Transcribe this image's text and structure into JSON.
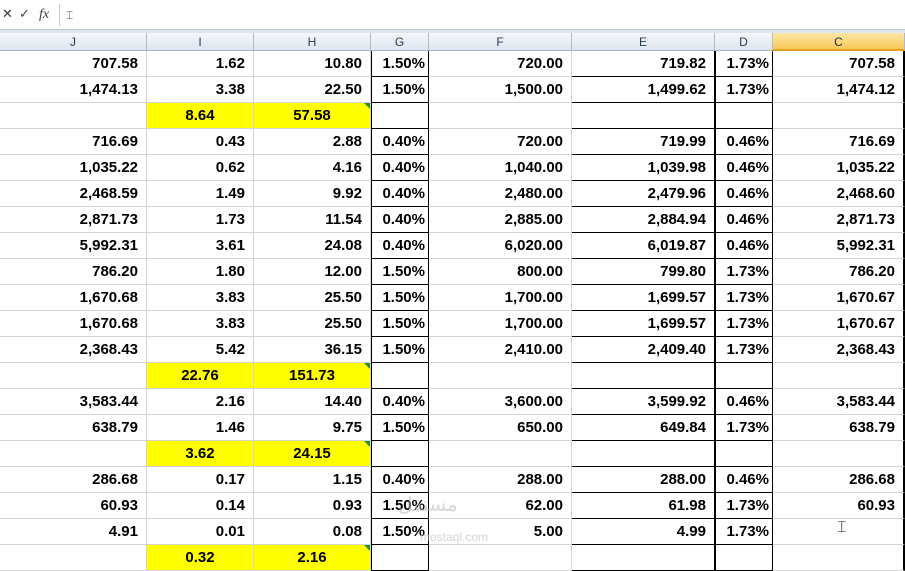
{
  "formula_bar": {
    "cancel_icon": "✕",
    "enter_icon": "✓",
    "fx_label": "fx",
    "value": ""
  },
  "columns": [
    "J",
    "I",
    "H",
    "G",
    "F",
    "E",
    "D",
    "C"
  ],
  "selected_column": "C",
  "rows": [
    {
      "J": "707.58",
      "I": "1.62",
      "H": "10.80",
      "G": "1.50%",
      "F": "720.00",
      "E": "719.82",
      "D": "1.73%",
      "C": "707.58"
    },
    {
      "J": "1,474.13",
      "I": "3.38",
      "H": "22.50",
      "G": "1.50%",
      "F": "1,500.00",
      "E": "1,499.62",
      "D": "1.73%",
      "C": "1,474.12"
    },
    {
      "J": "",
      "I": "8.64",
      "H": "57.58",
      "G": "",
      "F": "",
      "E": "",
      "D": "",
      "C": "",
      "yellow": true
    },
    {
      "J": "716.69",
      "I": "0.43",
      "H": "2.88",
      "G": "0.40%",
      "F": "720.00",
      "E": "719.99",
      "D": "0.46%",
      "C": "716.69"
    },
    {
      "J": "1,035.22",
      "I": "0.62",
      "H": "4.16",
      "G": "0.40%",
      "F": "1,040.00",
      "E": "1,039.98",
      "D": "0.46%",
      "C": "1,035.22"
    },
    {
      "J": "2,468.59",
      "I": "1.49",
      "H": "9.92",
      "G": "0.40%",
      "F": "2,480.00",
      "E": "2,479.96",
      "D": "0.46%",
      "C": "2,468.60"
    },
    {
      "J": "2,871.73",
      "I": "1.73",
      "H": "11.54",
      "G": "0.40%",
      "F": "2,885.00",
      "E": "2,884.94",
      "D": "0.46%",
      "C": "2,871.73"
    },
    {
      "J": "5,992.31",
      "I": "3.61",
      "H": "24.08",
      "G": "0.40%",
      "F": "6,020.00",
      "E": "6,019.87",
      "D": "0.46%",
      "C": "5,992.31"
    },
    {
      "J": "786.20",
      "I": "1.80",
      "H": "12.00",
      "G": "1.50%",
      "F": "800.00",
      "E": "799.80",
      "D": "1.73%",
      "C": "786.20"
    },
    {
      "J": "1,670.68",
      "I": "3.83",
      "H": "25.50",
      "G": "1.50%",
      "F": "1,700.00",
      "E": "1,699.57",
      "D": "1.73%",
      "C": "1,670.67"
    },
    {
      "J": "1,670.68",
      "I": "3.83",
      "H": "25.50",
      "G": "1.50%",
      "F": "1,700.00",
      "E": "1,699.57",
      "D": "1.73%",
      "C": "1,670.67"
    },
    {
      "J": "2,368.43",
      "I": "5.42",
      "H": "36.15",
      "G": "1.50%",
      "F": "2,410.00",
      "E": "2,409.40",
      "D": "1.73%",
      "C": "2,368.43"
    },
    {
      "J": "",
      "I": "22.76",
      "H": "151.73",
      "G": "",
      "F": "",
      "E": "",
      "D": "",
      "C": "",
      "yellow": true
    },
    {
      "J": "3,583.44",
      "I": "2.16",
      "H": "14.40",
      "G": "0.40%",
      "F": "3,600.00",
      "E": "3,599.92",
      "D": "0.46%",
      "C": "3,583.44"
    },
    {
      "J": "638.79",
      "I": "1.46",
      "H": "9.75",
      "G": "1.50%",
      "F": "650.00",
      "E": "649.84",
      "D": "1.73%",
      "C": "638.79"
    },
    {
      "J": "",
      "I": "3.62",
      "H": "24.15",
      "G": "",
      "F": "",
      "E": "",
      "D": "",
      "C": "",
      "yellow": true
    },
    {
      "J": "286.68",
      "I": "0.17",
      "H": "1.15",
      "G": "0.40%",
      "F": "288.00",
      "E": "288.00",
      "D": "0.46%",
      "C": "286.68"
    },
    {
      "J": "60.93",
      "I": "0.14",
      "H": "0.93",
      "G": "1.50%",
      "F": "62.00",
      "E": "61.98",
      "D": "1.73%",
      "C": "60.93"
    },
    {
      "J": "4.91",
      "I": "0.01",
      "H": "0.08",
      "G": "1.50%",
      "F": "5.00",
      "E": "4.99",
      "D": "1.73%",
      "C": ""
    },
    {
      "J": "",
      "I": "0.32",
      "H": "2.16",
      "G": "",
      "F": "",
      "E": "",
      "D": "",
      "C": "",
      "yellow": true
    }
  ],
  "watermark": "مستقل",
  "watermark_url": "mostaql.com",
  "colors": {
    "highlight": "#ffff00",
    "selected_header": "#f9c85a",
    "comment_marker": "#2f8f2f"
  }
}
